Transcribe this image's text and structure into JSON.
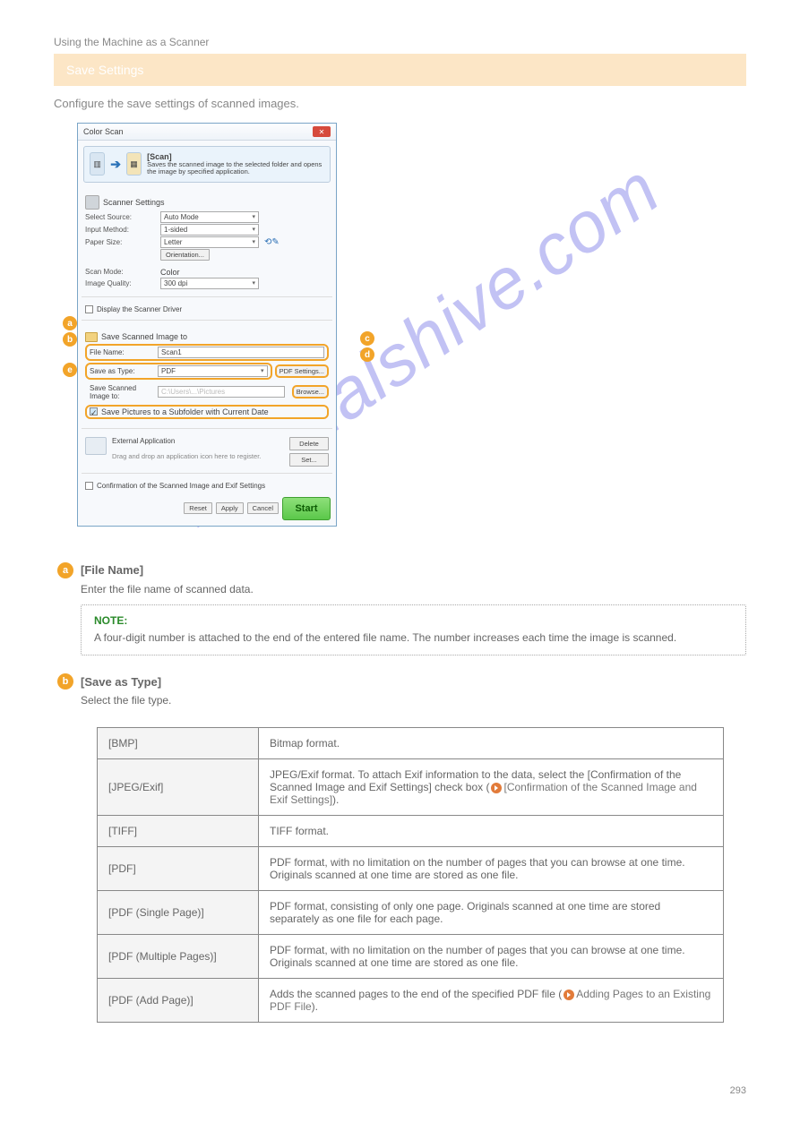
{
  "watermark": "manualshive.com",
  "header_link": "Using the Machine as a Scanner",
  "banner_title": "Save Settings",
  "subheading": "Configure the save settings of scanned images.",
  "dialog": {
    "title": "Color Scan",
    "close_x": "✕",
    "hero_title": "[Scan]",
    "hero_desc": "Saves the scanned image to the selected folder and opens the image by specified application.",
    "scanner_settings": "Scanner Settings",
    "rows": {
      "source_label": "Select Source:",
      "source_value": "Auto Mode",
      "input_label": "Input Method:",
      "input_value": "1-sided",
      "paper_label": "Paper Size:",
      "paper_value": "Letter",
      "orientation_btn": "Orientation...",
      "scanmode_label": "Scan Mode:",
      "scanmode_value": "Color",
      "quality_label": "Image Quality:",
      "quality_value": "300 dpi"
    },
    "display_driver_chk": "Display the Scanner Driver",
    "save_section": "Save Scanned Image to",
    "filename_label": "File Name:",
    "filename_value": "Scan1",
    "saveas_label": "Save as Type:",
    "saveas_value": "PDF",
    "pdf_btn": "PDF Settings...",
    "saveto_label": "Save Scanned Image to:",
    "saveto_value": "C:\\Users\\...\\Pictures",
    "browse_btn": "Browse...",
    "subfolder_chk": "Save Pictures to a Subfolder with Current Date",
    "ext_app": "External Application",
    "drag_hint": "Drag and drop an application icon here to register.",
    "delete_btn": "Delete",
    "set_btn": "Set...",
    "confirm_chk": "Confirmation of the Scanned Image and Exif Settings",
    "reset_btn": "Reset",
    "apply_btn": "Apply",
    "cancel_btn": "Cancel",
    "start_btn": "Start"
  },
  "callout_a": {
    "title": "[File Name]",
    "body": "Enter the file name of scanned data."
  },
  "note": {
    "label": "NOTE:",
    "text": "A four-digit number is attached to the end of the entered file name. The number increases each time the image is scanned."
  },
  "callout_b": {
    "title": "[Save as Type]",
    "body": "Select the file type."
  },
  "table": [
    {
      "k": "[BMP]",
      "v": "Bitmap format."
    },
    {
      "k": "[JPEG/Exif]",
      "v_pre": "JPEG/Exif format. To attach Exif information to the data, select the [Confirmation of the Scanned Image and Exif Settings] check box (",
      "v_link": "[Confirmation of the Scanned Image and Exif Settings]",
      "v_post": ")."
    },
    {
      "k": "[TIFF]",
      "v": "TIFF format."
    },
    {
      "k": "[PDF]",
      "v": "PDF format, with no limitation on the number of pages that you can browse at one time. Originals scanned at one time are stored as one file."
    },
    {
      "k": "[PDF (Single Page)]",
      "v": "PDF format, consisting of only one page. Originals scanned at one time are stored separately as one file for each page."
    },
    {
      "k": "[PDF (Multiple Pages)]",
      "v": "PDF format, with no limitation on the number of pages that you can browse at one time. Originals scanned at one time are stored as one file."
    },
    {
      "k": "[PDF (Add Page)]",
      "v_pre": "Adds the scanned pages to the end of the specified PDF file (",
      "v_link": "Adding Pages to an Existing PDF File",
      "v_post": ")."
    }
  ],
  "pagenum": "293"
}
